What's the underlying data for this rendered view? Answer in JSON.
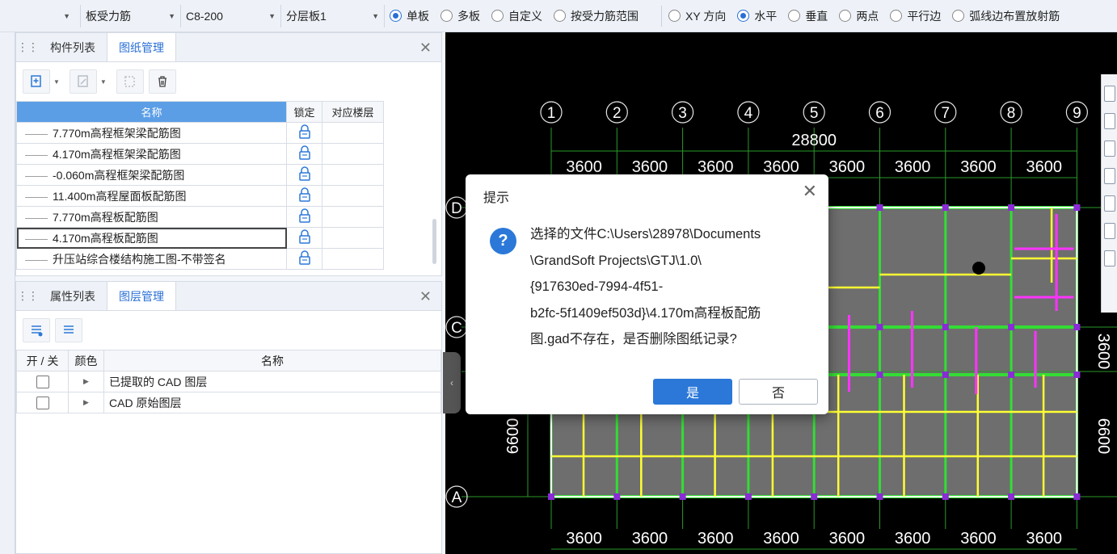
{
  "toolbar": {
    "dropdowns": [
      {
        "value": ""
      },
      {
        "value": "板受力筋"
      },
      {
        "value": "C8-200"
      },
      {
        "value": "分层板1"
      }
    ],
    "mode_radios": [
      {
        "label": "单板",
        "checked": true
      },
      {
        "label": "多板",
        "checked": false
      },
      {
        "label": "自定义",
        "checked": false
      },
      {
        "label": "按受力筋范围",
        "checked": false
      }
    ],
    "dir_radios": [
      {
        "label": "XY 方向",
        "checked": false
      },
      {
        "label": "水平",
        "checked": true
      },
      {
        "label": "垂直",
        "checked": false
      },
      {
        "label": "两点",
        "checked": false
      },
      {
        "label": "平行边",
        "checked": false
      },
      {
        "label": "弧线边布置放射筋",
        "checked": false
      }
    ]
  },
  "drawings_panel": {
    "tabs": [
      "构件列表",
      "图纸管理"
    ],
    "active_tab": "图纸管理",
    "columns": {
      "name": "名称",
      "lock": "锁定",
      "floor": "对应楼层"
    },
    "rows": [
      {
        "name": "7.770m高程框架梁配筋图",
        "floor": ""
      },
      {
        "name": "4.170m高程框架梁配筋图",
        "floor": ""
      },
      {
        "name": "-0.060m高程框架梁配筋图",
        "floor": ""
      },
      {
        "name": "11.400m高程屋面板配筋图",
        "floor": ""
      },
      {
        "name": "7.770m高程板配筋图",
        "floor": ""
      },
      {
        "name": "4.170m高程板配筋图",
        "floor": "",
        "selected": true
      },
      {
        "name": "升压站综合楼结构施工图-不带签名",
        "floor": ""
      }
    ]
  },
  "layers_panel": {
    "tabs": [
      "属性列表",
      "图层管理"
    ],
    "active_tab": "图层管理",
    "columns": {
      "toggle": "开 / 关",
      "color": "颜色",
      "name": "名称"
    },
    "rows": [
      {
        "name": "已提取的 CAD 图层"
      },
      {
        "name": "CAD 原始图层"
      }
    ]
  },
  "cad": {
    "col_axes": [
      "1",
      "2",
      "3",
      "4",
      "5",
      "6",
      "7",
      "8",
      "9"
    ],
    "row_axes": [
      "D",
      "C",
      "A"
    ],
    "total_dim": "28800",
    "spans_top": [
      "3600",
      "3600",
      "3600",
      "3600",
      "3600",
      "3600",
      "3600",
      "3600"
    ],
    "spans_bottom": [
      "3600",
      "3600",
      "3600",
      "3600",
      "3600",
      "3600",
      "3600",
      "3600"
    ],
    "left_dim": "6600",
    "right_dim_1": "3600",
    "right_dim_2": "6600"
  },
  "dialog": {
    "title": "提示",
    "message_lines": [
      "选择的文件C:\\Users\\28978\\Documents",
      "\\GrandSoft Projects\\GTJ\\1.0\\",
      "{917630ed-7994-4f51-",
      "b2fc-5f1409ef503d}\\4.170m高程板配筋",
      "图.gad不存在，是否删除图纸记录?"
    ],
    "yes_label": "是",
    "no_label": "否"
  },
  "colors": {
    "accent": "#2b78d8",
    "header_blue": "#5b9ee6",
    "cad_green": "#33dd33",
    "cad_yellow": "#ffff33",
    "cad_magenta": "#ff33ff",
    "cad_slab": "#6e6e6e"
  }
}
